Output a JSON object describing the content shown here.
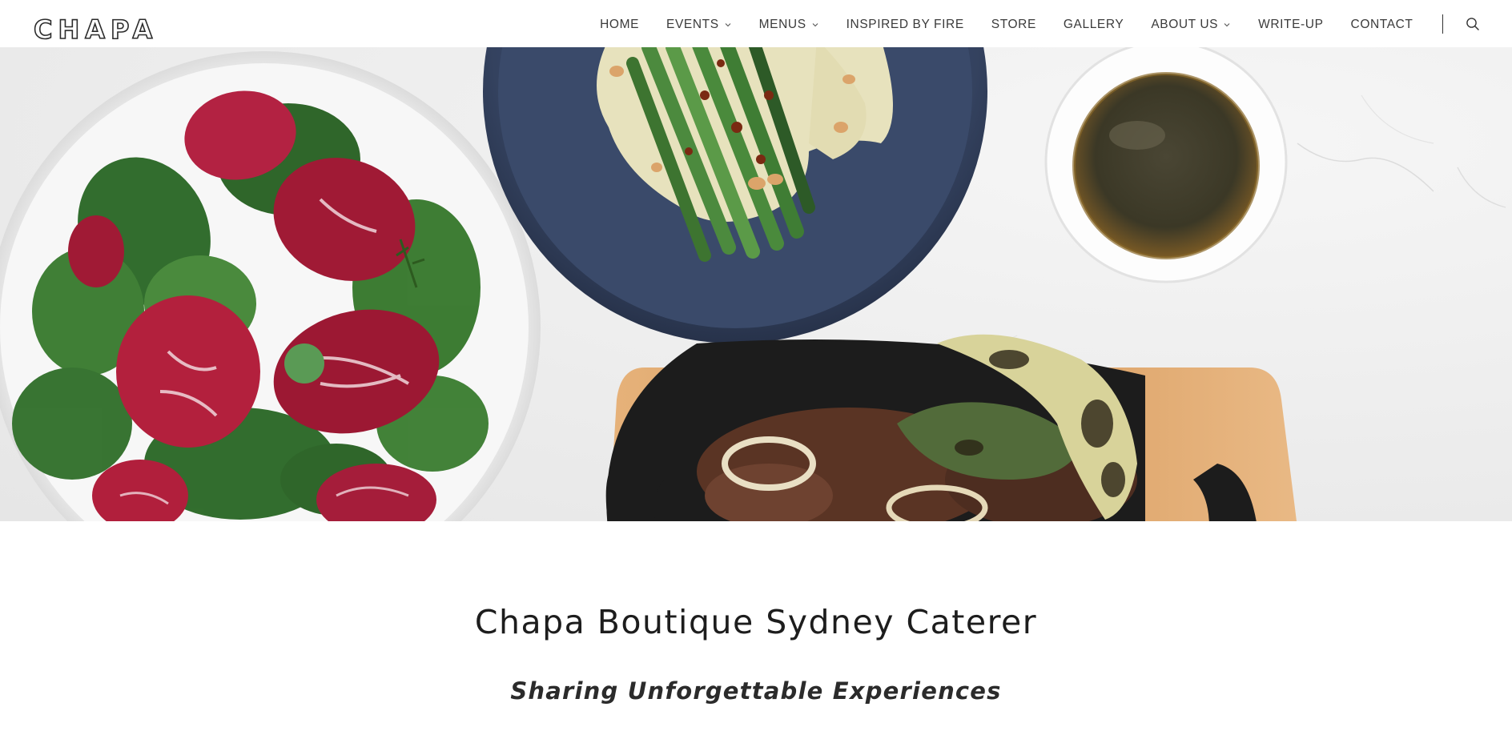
{
  "brand": {
    "logo_text": "CHAPA"
  },
  "nav": {
    "items": [
      {
        "label": "HOME",
        "has_dropdown": false
      },
      {
        "label": "EVENTS",
        "has_dropdown": true
      },
      {
        "label": "MENUS",
        "has_dropdown": true
      },
      {
        "label": "INSPIRED BY FIRE",
        "has_dropdown": false
      },
      {
        "label": "STORE",
        "has_dropdown": false
      },
      {
        "label": "GALLERY",
        "has_dropdown": false
      },
      {
        "label": "ABOUT US",
        "has_dropdown": true
      },
      {
        "label": "WRITE-UP",
        "has_dropdown": false
      },
      {
        "label": "CONTACT",
        "has_dropdown": false
      }
    ],
    "search_icon": "search-icon"
  },
  "hero": {
    "image_subject": "overhead food spread: radicchio salad, asparagus on hummus, dipping sauce, grilled meat and peppers in cast iron pan"
  },
  "intro": {
    "title": "Chapa Boutique Sydney Caterer",
    "subtitle": "Sharing Unforgettable Experiences"
  },
  "colors": {
    "header_bg": "#ffffff",
    "nav_text": "#3a3a3a",
    "title_text": "#1d1d1d",
    "plate_blue": "#3a4a6a",
    "radicchio": "#a01a35",
    "spinach": "#2f6b2a"
  }
}
